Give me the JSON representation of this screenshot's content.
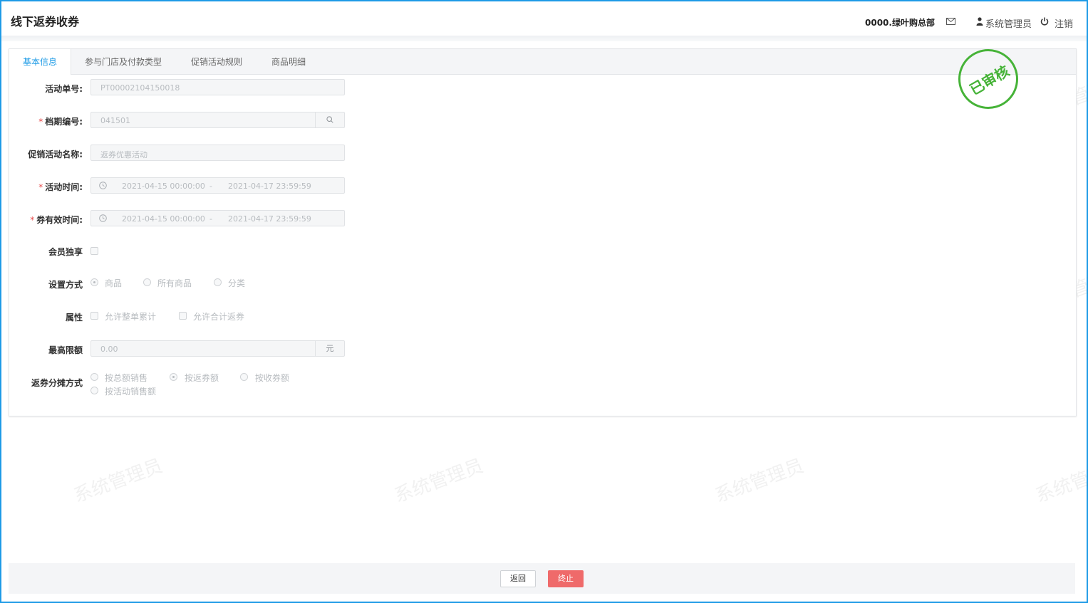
{
  "header": {
    "title": "线下返券收券",
    "org": "0000.绿叶购总部",
    "user": "系统管理员",
    "logout": "注销"
  },
  "tabs": [
    {
      "label": "基本信息",
      "active": true
    },
    {
      "label": "参与门店及付款类型"
    },
    {
      "label": "促销活动规则"
    },
    {
      "label": "商品明细"
    }
  ],
  "stamp": "已审核",
  "watermark": "系统管理员",
  "form": {
    "activity_no": {
      "label": "活动单号:",
      "value": "PT00002104150018"
    },
    "period_no": {
      "label": "档期编号:",
      "value": "041501",
      "required": true
    },
    "promo_name": {
      "label": "促销活动名称:",
      "value": "返券优惠活动"
    },
    "activity_time": {
      "label": "活动时间:",
      "start": "2021-04-15 00:00:00",
      "sep": "-",
      "end": "2021-04-17 23:59:59",
      "required": true
    },
    "coupon_valid_time": {
      "label": "券有效时间:",
      "start": "2021-04-15 00:00:00",
      "sep": "-",
      "end": "2021-04-17 23:59:59",
      "required": true
    },
    "member_only": {
      "label": "会员独享",
      "checked": false
    },
    "setting_mode": {
      "label": "设置方式",
      "options": [
        "商品",
        "所有商品",
        "分类"
      ],
      "selected": "商品"
    },
    "attributes": {
      "label": "属性",
      "options": [
        "允许整单累计",
        "允许合计返券"
      ]
    },
    "max_limit": {
      "label": "最高限额",
      "value": "0.00",
      "unit": "元"
    },
    "allocation": {
      "label": "返券分摊方式",
      "options": [
        "按总额销售",
        "按返券额",
        "按收券额",
        "按活动销售额"
      ],
      "selected": "按返券额"
    }
  },
  "footer": {
    "back": "返回",
    "stop": "终止"
  },
  "colors": {
    "accent": "#1e9be6",
    "stamp": "#46b338",
    "danger": "#ef6a6a"
  }
}
